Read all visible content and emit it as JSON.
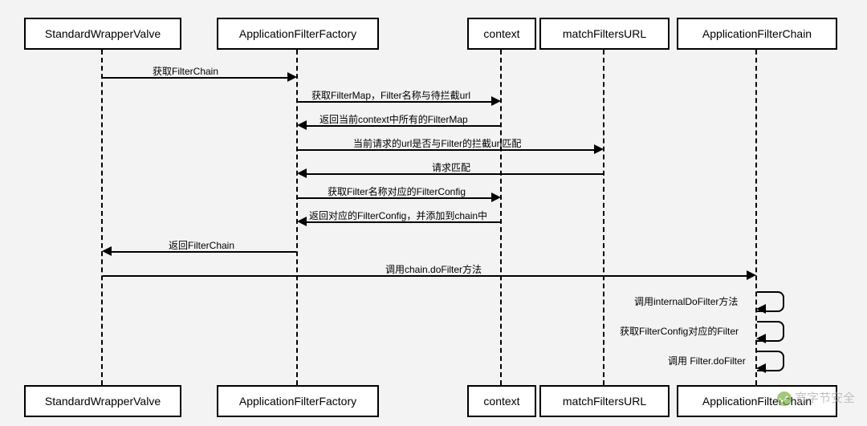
{
  "chart_data": {
    "type": "sequence",
    "participants": [
      "StandardWrapperValve",
      "ApplicationFilterFactory",
      "context",
      "matchFiltersURL",
      "ApplicationFilterChain"
    ],
    "messages": [
      {
        "from": "StandardWrapperValve",
        "to": "ApplicationFilterFactory",
        "text": "获取FilterChain",
        "dir": "r"
      },
      {
        "from": "ApplicationFilterFactory",
        "to": "context",
        "text": "获取FilterMap，Filter名称与待拦截url",
        "dir": "r"
      },
      {
        "from": "context",
        "to": "ApplicationFilterFactory",
        "text": "返回当前context中所有的FilterMap",
        "dir": "l"
      },
      {
        "from": "ApplicationFilterFactory",
        "to": "matchFiltersURL",
        "text": "当前请求的url是否与Filter的拦截url匹配",
        "dir": "r"
      },
      {
        "from": "matchFiltersURL",
        "to": "ApplicationFilterFactory",
        "text": "请求匹配",
        "dir": "l"
      },
      {
        "from": "ApplicationFilterFactory",
        "to": "context",
        "text": "获取Filter名称对应的FilterConfig",
        "dir": "r"
      },
      {
        "from": "context",
        "to": "ApplicationFilterFactory",
        "text": "返回对应的FilterConfig，并添加到chain中",
        "dir": "l"
      },
      {
        "from": "ApplicationFilterFactory",
        "to": "StandardWrapperValve",
        "text": "返回FilterChain",
        "dir": "l"
      },
      {
        "from": "StandardWrapperValve",
        "to": "ApplicationFilterChain",
        "text": "调用chain.doFilter方法",
        "dir": "r"
      },
      {
        "from": "ApplicationFilterChain",
        "to": "ApplicationFilterChain",
        "text": "调用internalDoFilter方法",
        "dir": "self"
      },
      {
        "from": "ApplicationFilterChain",
        "to": "ApplicationFilterChain",
        "text": "获取FilterConfig对应的Filter",
        "dir": "self"
      },
      {
        "from": "ApplicationFilterChain",
        "to": "ApplicationFilterChain",
        "text": "调用 Filter.doFilter",
        "dir": "self"
      }
    ]
  },
  "actors": {
    "a1": "StandardWrapperValve",
    "a2": "ApplicationFilterFactory",
    "a3": "context",
    "a4": "matchFiltersURL",
    "a5": "ApplicationFilterChain"
  },
  "labels": {
    "m1": "获取FilterChain",
    "m2": "获取FilterMap，Filter名称与待拦截url",
    "m3": "返回当前context中所有的FilterMap",
    "m4": "当前请求的url是否与Filter的拦截url匹配",
    "m5": "请求匹配",
    "m6": "获取Filter名称对应的FilterConfig",
    "m7": "返回对应的FilterConfig，并添加到chain中",
    "m8": "返回FilterChain",
    "m9": "调用chain.doFilter方法",
    "m10": "调用internalDoFilter方法",
    "m11": "获取FilterConfig对应的Filter",
    "m12": "调用 Filter.doFilter"
  },
  "watermark": "宽字节安全"
}
